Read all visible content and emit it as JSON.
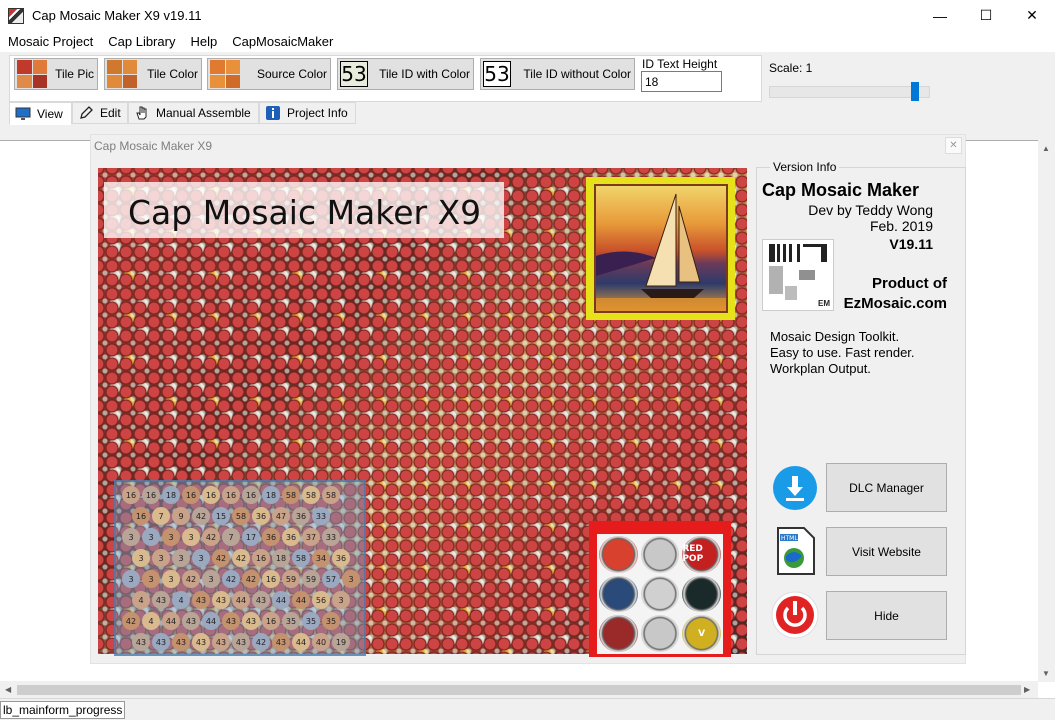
{
  "window": {
    "title": "Cap Mosaic Maker X9 v19.11",
    "controls": {
      "minimize": "—",
      "maximize": "☐",
      "close": "✕"
    }
  },
  "menu": [
    "Mosaic Project",
    "Cap Library",
    "Help",
    "CapMosaicMaker"
  ],
  "toolbar": {
    "tile_pic": "Tile Pic",
    "tile_color": "Tile Color",
    "source_color": "Source Color",
    "tile_id_with_color": "Tile ID with Color",
    "tile_id_without_color": "Tile ID without Color",
    "id_sample_number": "53",
    "id_text_height_label": "ID Text Height",
    "id_text_height_value": "18",
    "scale_label": "Scale: 1",
    "scale_value": 1
  },
  "tabs": [
    {
      "label": "View",
      "icon": "monitor-icon",
      "active": true
    },
    {
      "label": "Edit",
      "icon": "pencil-icon",
      "active": false
    },
    {
      "label": "Manual Assemble",
      "icon": "hand-icon",
      "active": false
    },
    {
      "label": "Project Info",
      "icon": "info-icon",
      "active": false
    }
  ],
  "child_window": {
    "title": "Cap Mosaic Maker X9",
    "close": "✕",
    "mosaic_title": "Cap Mosaic Maker X9",
    "id_grid_rows": [
      [
        "16",
        "16",
        "18",
        "16",
        "16",
        "16",
        "16",
        "18",
        "58",
        "58",
        "58"
      ],
      [
        "16",
        "7",
        "9",
        "42",
        "15",
        "58",
        "36",
        "47",
        "36",
        "33"
      ],
      [
        "3",
        "3",
        "3",
        "3",
        "42",
        "7",
        "17",
        "36",
        "36",
        "37",
        "33"
      ],
      [
        "3",
        "3",
        "3",
        "3",
        "42",
        "42",
        "16",
        "18",
        "58",
        "34",
        "36"
      ],
      [
        "3",
        "3",
        "3",
        "42",
        "3",
        "42",
        "42",
        "16",
        "59",
        "59",
        "57",
        "3"
      ],
      [
        "4",
        "43",
        "4",
        "43",
        "43",
        "44",
        "43",
        "44",
        "44",
        "56",
        "3"
      ],
      [
        "42",
        "4",
        "44",
        "43",
        "44",
        "43",
        "43",
        "16",
        "35",
        "35",
        "35"
      ],
      [
        "43",
        "43",
        "43",
        "43",
        "43",
        "43",
        "42",
        "43",
        "44",
        "40",
        "19"
      ]
    ],
    "caps": [
      {
        "label": "",
        "color": "#d9412f",
        "icon": "owl-cap-icon"
      },
      {
        "label": "",
        "color": "#c8c8c8",
        "icon": "red-logo-cap-icon"
      },
      {
        "label": "RED POP",
        "color": "#c42020",
        "icon": "red-pop-cap-icon"
      },
      {
        "label": "",
        "color": "#2a4a7a",
        "icon": "blue-cap-icon"
      },
      {
        "label": "",
        "color": "#d0d0d0",
        "icon": "silver-cap-icon"
      },
      {
        "label": "",
        "color": "#1a2a2a",
        "icon": "dark-cap-icon"
      },
      {
        "label": "",
        "color": "#9a2a2a",
        "icon": "red-seal-cap-icon"
      },
      {
        "label": "",
        "color": "#c8c8c8",
        "icon": "white-cap-icon"
      },
      {
        "label": "V",
        "color": "#d0b020",
        "icon": "gold-v-cap-icon"
      }
    ]
  },
  "version_info": {
    "legend": "Version Info",
    "app_name": "Cap Mosaic Maker",
    "developer": "Dev by Teddy Wong",
    "date": "Feb. 2019",
    "version": "V19.11",
    "product_of": "Product of",
    "brand": "EzMosaic.com",
    "logo_text": "EM",
    "desc_lines": [
      "Mosaic Design Toolkit.",
      "Easy to use. Fast render.",
      "Workplan Output."
    ],
    "buttons": [
      {
        "label": "DLC Manager",
        "icon": "download-icon"
      },
      {
        "label": "Visit Website",
        "icon": "html-globe-icon"
      },
      {
        "label": "Hide",
        "icon": "power-icon"
      }
    ]
  },
  "status": {
    "text": "lb_mainform_progress"
  }
}
